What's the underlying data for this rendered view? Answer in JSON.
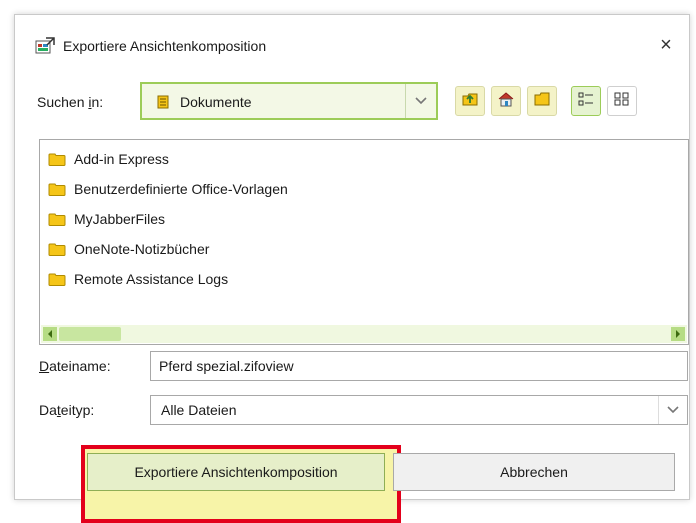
{
  "dialog": {
    "title": "Exportiere Ansichtenkomposition",
    "close_symbol": "×",
    "app_icon": "export-view-icon"
  },
  "lookin": {
    "label_prefix": "Suchen ",
    "label_access": "i",
    "label_suffix": "n:",
    "value": "Dokumente",
    "icon": "documents-icon"
  },
  "toolbar": {
    "buttons": [
      {
        "name": "up-one-level-icon"
      },
      {
        "name": "home-icon"
      },
      {
        "name": "new-folder-icon"
      },
      {
        "name": "list-view-icon"
      },
      {
        "name": "details-view-icon"
      }
    ]
  },
  "files": [
    {
      "name": "Add-in Express",
      "icon": "folder-icon"
    },
    {
      "name": "Benutzerdefinierte Office-Vorlagen",
      "icon": "folder-icon"
    },
    {
      "name": "MyJabberFiles",
      "icon": "folder-icon"
    },
    {
      "name": "OneNote-Notizbücher",
      "icon": "folder-icon"
    },
    {
      "name": "Remote Assistance Logs",
      "icon": "folder-icon"
    }
  ],
  "filename": {
    "label_access": "D",
    "label_rest": "ateiname:",
    "value": "Pferd spezial.zifoview"
  },
  "filetype": {
    "label_prefix": "Da",
    "label_access": "t",
    "label_suffix": "eityp:",
    "value": "Alle Dateien"
  },
  "buttons": {
    "export": "Exportiere Ansichtenkomposition",
    "cancel": "Abbrechen"
  },
  "colors": {
    "accent_green": "#9ccc58",
    "highlight_fill": "#f7f4a8",
    "highlight_border": "#e3001b",
    "folder_yellow": "#f5c518"
  }
}
